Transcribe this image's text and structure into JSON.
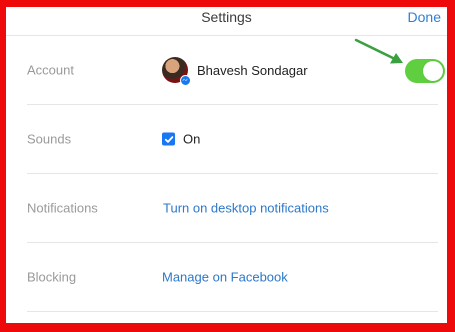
{
  "header": {
    "title": "Settings",
    "done_label": "Done"
  },
  "rows": {
    "account": {
      "label": "Account",
      "user_name": "Bhavesh Sondagar",
      "toggle_on": true
    },
    "sounds": {
      "label": "Sounds",
      "checkbox_label": "On",
      "checked": true
    },
    "notifications": {
      "label": "Notifications",
      "link": "Turn on desktop notifications"
    },
    "blocking": {
      "label": "Blocking",
      "link": "Manage on Facebook"
    }
  },
  "colors": {
    "frame": "#ee0a0a",
    "toggle": "#5fcf3f",
    "link": "#2d78c8",
    "done": "#2f7fd6",
    "annotation_arrow": "#3aa040"
  },
  "icons": {
    "avatar_badge": "messenger-icon",
    "checkbox": "checkmark-icon",
    "annotation": "arrow-icon"
  }
}
